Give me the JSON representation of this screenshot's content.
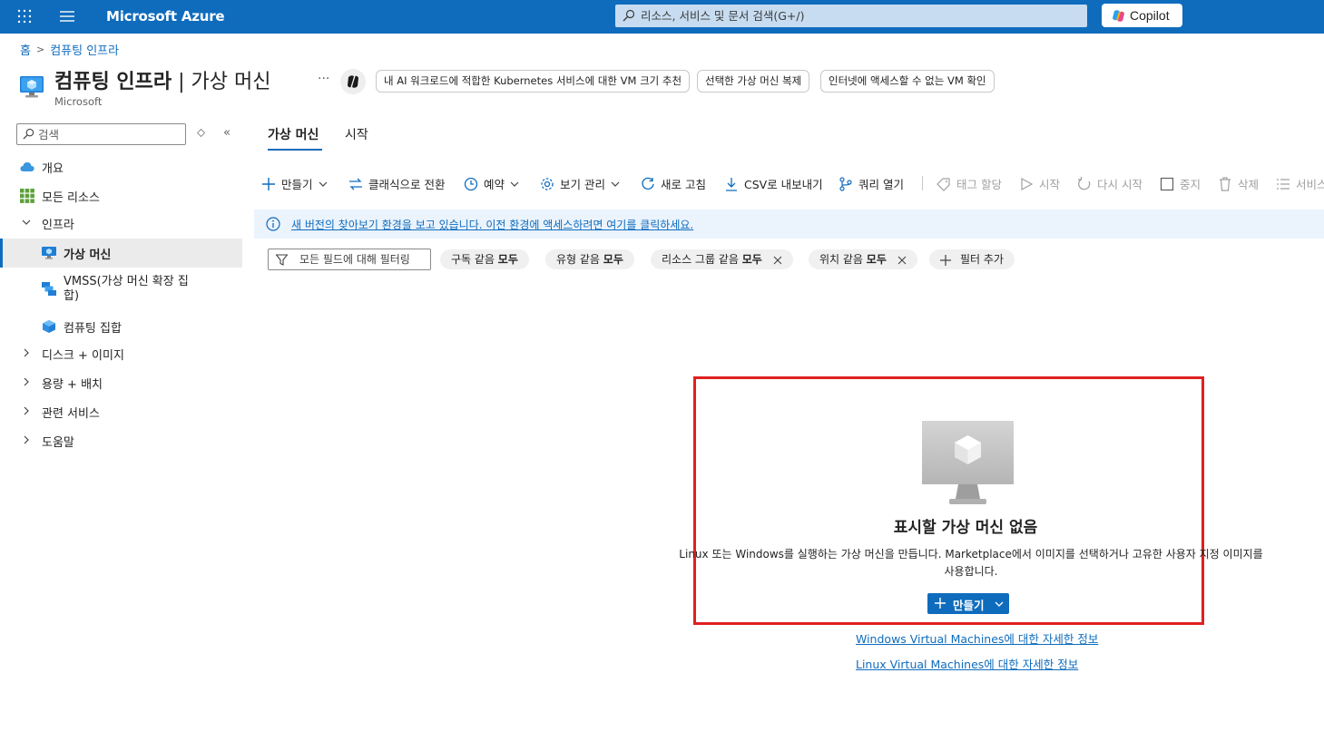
{
  "topbar": {
    "brand": "Microsoft Azure",
    "search_placeholder": "리소스, 서비스 및 문서 검색(G+/)",
    "copilot_label": "Copilot",
    "bar_color": "#0f6cbd"
  },
  "breadcrumb": {
    "home": "홈",
    "current": "컴퓨팅 인프라"
  },
  "header": {
    "title_main": "컴퓨팅 인프라",
    "title_sep": " | ",
    "title_sub": "가상 머신",
    "subtitle": "Microsoft",
    "more": "···",
    "suggestions": [
      "내 AI 워크로드에 적합한 Kubernetes 서비스에 대한 VM 크기 추천",
      "선택한 가상 머신 복제",
      "인터넷에 액세스할 수 없는 VM 확인"
    ]
  },
  "sidebar": {
    "search_placeholder": "검색",
    "items": [
      {
        "label": "개요"
      },
      {
        "label": "모든 리소스"
      },
      {
        "label": "인프라"
      },
      {
        "label": "가상 머신"
      },
      {
        "label": "VMSS(가상 머신 확장 집합)"
      },
      {
        "label": "컴퓨팅 집합"
      },
      {
        "label": "디스크 + 이미지"
      },
      {
        "label": "용량 + 배치"
      },
      {
        "label": "관련 서비스"
      },
      {
        "label": "도움말"
      }
    ]
  },
  "tabs": [
    {
      "label": "가상 머신"
    },
    {
      "label": "시작"
    }
  ],
  "toolbar": {
    "create": "만들기",
    "classic": "클래식으로 전환",
    "reserve": "예약",
    "view": "보기 관리",
    "refresh": "새로 고침",
    "csv": "CSV로 내보내기",
    "query": "쿼리 열기",
    "tag": "태그 할당",
    "start": "시작",
    "restart": "다시 시작",
    "stop": "중지",
    "delete": "삭제",
    "services": "서비스"
  },
  "infobar": {
    "text": "새 버전의 찾아보기 환경을 보고 있습니다. 이전 환경에 액세스하려면 여기를 클릭하세요."
  },
  "filters": {
    "placeholder": "모든 필드에 대해 필터링",
    "chips": [
      {
        "prefix": "구독 같음 ",
        "value": "모두"
      },
      {
        "prefix": "유형 같음 ",
        "value": "모두"
      },
      {
        "prefix": "리소스 그룹 같음 ",
        "value": "모두"
      },
      {
        "prefix": "위치 같음 ",
        "value": "모두"
      }
    ],
    "add": "필터 추가"
  },
  "empty": {
    "title": "표시할 가상 머신 없음",
    "desc_line1": "Linux 또는 Windows를 실행하는 가상 머신을 만듭니다. Marketplace에서 이미지를 선택하거나 고유한 사용자 지정 이미지를",
    "desc_line2": "사용합니다.",
    "create": "만들기",
    "link_windows": "Windows Virtual Machines에 대한 자세한 정보",
    "link_linux": "Linux Virtual Machines에 대한 자세한 정보"
  }
}
